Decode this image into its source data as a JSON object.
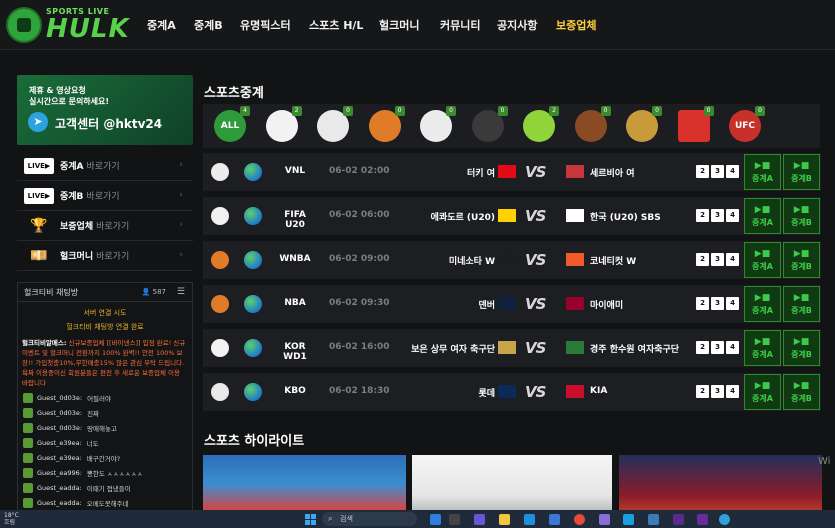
{
  "brand": {
    "sub": "SPORTS LIVE",
    "main": "HULK"
  },
  "nav": [
    {
      "label": "중계A",
      "active": false
    },
    {
      "label": "중계B",
      "active": false
    },
    {
      "label": "유명픽스터",
      "active": false
    },
    {
      "label": "스포츠 H/L",
      "active": false
    },
    {
      "label": "헐크머니",
      "active": false
    },
    {
      "label": "커뮤니티",
      "active": false
    },
    {
      "label": "공지사항",
      "active": false
    },
    {
      "label": "보증업체",
      "active": true
    }
  ],
  "promo": {
    "line1": "제휴 & 영상요청",
    "line2": "실시간으로 문의하세요!",
    "cta": "고객센터 @hktv24"
  },
  "side_links": [
    {
      "icon": "live-icon",
      "label": "중계A",
      "sub": "바로가기"
    },
    {
      "icon": "live-icon",
      "label": "중계B",
      "sub": "바로가기"
    },
    {
      "icon": "trophy-icon",
      "label": "보증업체",
      "sub": "바로가기"
    },
    {
      "icon": "money-icon",
      "label": "헐크머니",
      "sub": "바로가기"
    }
  ],
  "chat": {
    "title": "헐크티비 채팅방",
    "count": "587",
    "system1": "서버 연결 시도",
    "system2": "헐크티비 채팅방 연결 완료",
    "notice_user": "헐크티비알메스:",
    "notice_text": "신규보증업체 [[바이낸스]] 입점 완료! 신규 이벤트 및 헐크머니 전환까지 100% 완벽!! 안전 100% 보장!! 가입첫충10%,무한매충15% 많은 관심 부탁 드립니다. 욕짜 이용중이신 회원분들은 편전 후 새로운 보증업체 이용 바랍니다",
    "messages": [
      {
        "user": "Guest_0d03e:",
        "text": "어필러야"
      },
      {
        "user": "Guest_0d03e:",
        "text": "진짜"
      },
      {
        "user": "Guest_0d03e:",
        "text": "땅에해놓고"
      },
      {
        "user": "Guest_e39ea:",
        "text": "너도"
      },
      {
        "user": "Guest_e39ea:",
        "text": "배구간거야?"
      },
      {
        "user": "Guest_ea996:",
        "text": "뽕한도 ㅅㅅㅅㅅㅅㅅ"
      },
      {
        "user": "Guest_eadda:",
        "text": "이때기 접냈들이"
      },
      {
        "user": "Guest_eadda:",
        "text": "오메도못해주네"
      }
    ]
  },
  "sections": {
    "live": "스포츠중계",
    "highlight": "스포츠 하이라이트"
  },
  "sports": [
    {
      "name": "ALL",
      "count": "4",
      "icon": "all-icon",
      "color": "#2f9a3a"
    },
    {
      "name": "",
      "count": "2",
      "icon": "soccer-icon",
      "color": "#f2f2f2"
    },
    {
      "name": "",
      "count": "0",
      "icon": "baseball-icon",
      "color": "#e9e9e9"
    },
    {
      "name": "",
      "count": "0",
      "icon": "basketball-icon",
      "color": "#e07b28"
    },
    {
      "name": "",
      "count": "0",
      "icon": "volleyball-icon",
      "color": "#ececec"
    },
    {
      "name": "",
      "count": "0",
      "icon": "hockey-icon",
      "color": "#3a3a3a"
    },
    {
      "name": "",
      "count": "2",
      "icon": "tennis-icon",
      "color": "#8fd43a"
    },
    {
      "name": "",
      "count": "0",
      "icon": "football-icon",
      "color": "#8a4a24"
    },
    {
      "name": "",
      "count": "0",
      "icon": "lol-icon",
      "color": "#c89a3a"
    },
    {
      "name": "",
      "count": "0",
      "icon": "esport-icon",
      "color": "#d8312a"
    },
    {
      "name": "UFC",
      "count": "0",
      "icon": "ufc-icon",
      "color": "#c8302a"
    }
  ],
  "tabs": [
    "2",
    "3",
    "4"
  ],
  "buttons": {
    "a": "중계A",
    "b": "중계B"
  },
  "matches": [
    {
      "league": "VNL",
      "time": "06-02 02:00",
      "home": "터키 여",
      "away": "세르비아 여",
      "ball": "volleyball-icon",
      "ballColor": "#ececec",
      "hflag": "#e30a17",
      "aflag": "#c6363c"
    },
    {
      "league": "FIFA U20",
      "time": "06-02 06:00",
      "home": "에콰도르 (U20)",
      "away": "한국 (U20) SBS",
      "ball": "soccer-icon",
      "ballColor": "#f2f2f2",
      "hflag": "#ffd100",
      "aflag": "#ffffff"
    },
    {
      "league": "WNBA",
      "time": "06-02 09:00",
      "home": "미네소타 W",
      "away": "코네티컷 W",
      "ball": "basketball-icon",
      "ballColor": "#e07b28",
      "hflag": "#1b1d20",
      "aflag": "#f05a28"
    },
    {
      "league": "NBA",
      "time": "06-02 09:30",
      "home": "덴버",
      "away": "마이애미",
      "ball": "basketball-icon",
      "ballColor": "#e07b28",
      "hflag": "#0e2240",
      "aflag": "#98002e"
    },
    {
      "league": "KOR WD1",
      "time": "06-02 16:00",
      "home": "보은 상무 여자 축구단",
      "away": "경주 한수원 여자축구단",
      "ball": "soccer-icon",
      "ballColor": "#f2f2f2",
      "hflag": "#c9a54a",
      "aflag": "#2a7a3a"
    },
    {
      "league": "KBO",
      "time": "06-02 18:30",
      "home": "롯데",
      "away": "KIA",
      "ball": "baseball-icon",
      "ballColor": "#e9e9e9",
      "hflag": "#0b2a5a",
      "aflag": "#c8102e"
    }
  ],
  "taskbar": {
    "temp": "18°C",
    "cond": "흐림",
    "search": "검색"
  },
  "watermark": "Wi"
}
